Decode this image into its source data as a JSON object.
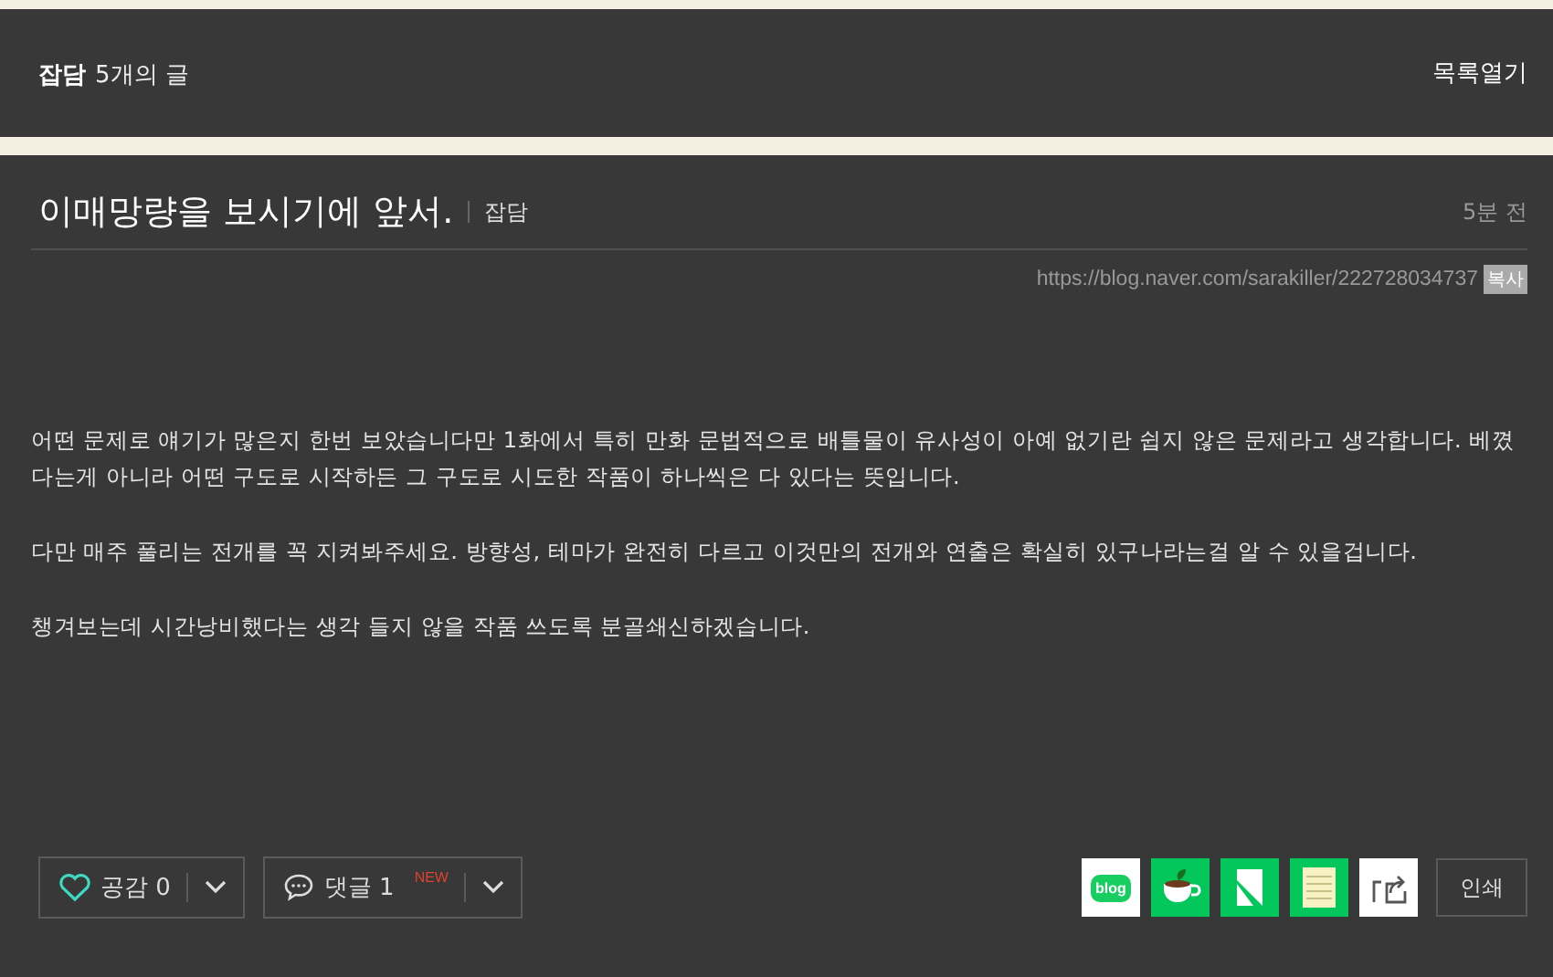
{
  "header": {
    "category": "잡담",
    "count": "5개의 글",
    "toggle": "목록열기"
  },
  "post": {
    "title": "이매망량을 보시기에 앞서.",
    "category": "잡담",
    "time": "5분 전",
    "url": "https://blog.naver.com/sarakiller/222728034737",
    "copy": "복사",
    "paragraphs": [
      "어떤 문제로 얘기가 많은지 한번 보았습니다만 1화에서 특히 만화 문법적으로 배틀물이 유사성이 아예 없기란 쉽지 않은 문제라고 생각합니다. 베꼈다는게 아니라 어떤 구도로 시작하든 그 구도로 시도한 작품이 하나씩은 다 있다는 뜻입니다.",
      "다만 매주 풀리는 전개를 꼭 지켜봐주세요. 방향성, 테마가 완전히 다르고 이것만의 전개와 연출은 확실히 있구나라는걸 알 수 있을겁니다.",
      "챙겨보는데 시간낭비했다는 생각 들지 않을 작품 쓰도록 분골쇄신하겠습니다."
    ]
  },
  "footer": {
    "like": {
      "label": "공감 0"
    },
    "comment": {
      "label": "댓글 1",
      "badge": "NEW"
    },
    "shares": [
      {
        "kind": "blog",
        "text": "blog"
      },
      {
        "kind": "cafe"
      },
      {
        "kind": "keep"
      },
      {
        "kind": "memo"
      },
      {
        "kind": "share"
      }
    ],
    "print": "인쇄"
  }
}
